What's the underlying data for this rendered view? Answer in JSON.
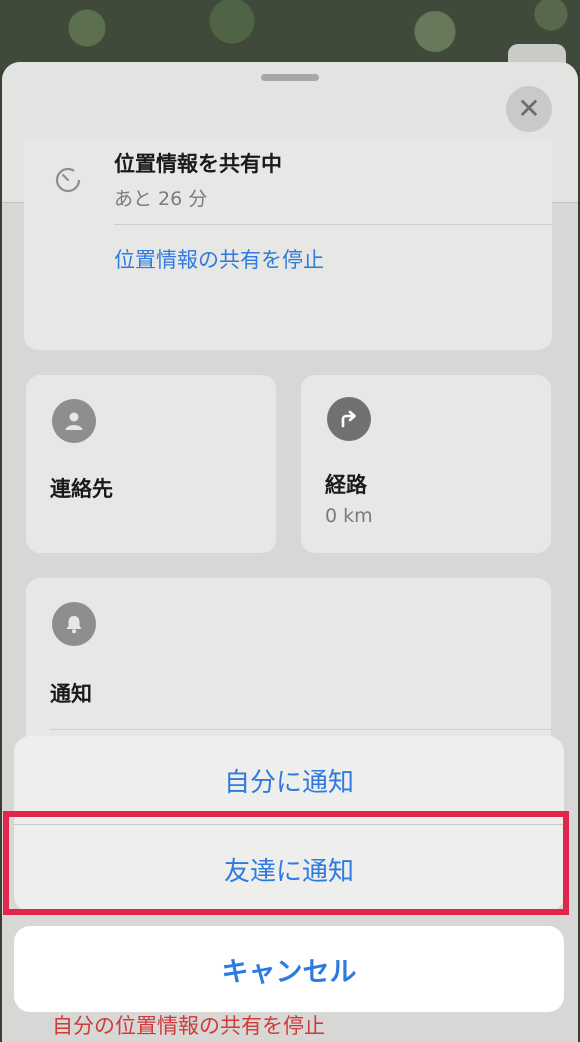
{
  "share": {
    "title": "位置情報を共有中",
    "remaining": "あと 26 分",
    "stop_label": "位置情報の共有を停止"
  },
  "contact": {
    "title": "連絡先"
  },
  "route": {
    "title": "経路",
    "distance": "0 km"
  },
  "notify": {
    "title": "通知"
  },
  "bottom_link": "自分の位置情報の共有を停止",
  "action_sheet": {
    "notify_me": "自分に通知",
    "notify_friend": "友達に通知",
    "cancel": "キャンセル"
  },
  "colors": {
    "accent": "#2f7ae0",
    "highlight": "#e0264d",
    "destructive": "#d13a3a"
  },
  "icons": [
    "close-icon",
    "timer-icon",
    "person-icon",
    "route-arrow-icon",
    "bell-icon"
  ]
}
